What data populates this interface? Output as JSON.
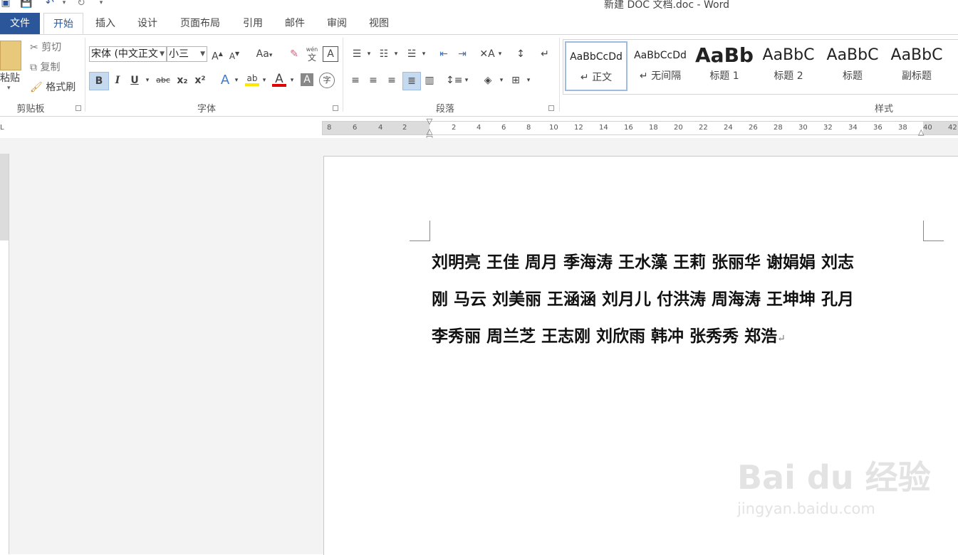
{
  "title": "新建 DOC 文档.doc - Word",
  "tabs": [
    {
      "label": "文件"
    },
    {
      "label": "开始"
    },
    {
      "label": "插入"
    },
    {
      "label": "设计"
    },
    {
      "label": "页面布局"
    },
    {
      "label": "引用"
    },
    {
      "label": "邮件"
    },
    {
      "label": "审阅"
    },
    {
      "label": "视图"
    }
  ],
  "clipboard": {
    "paste": "粘贴",
    "cut": "剪切",
    "copy": "复制",
    "format_painter": "格式刷",
    "group_label": "剪贴板"
  },
  "font": {
    "font_name": "宋体 (中文正文",
    "font_size": "小三",
    "group_label": "字体",
    "bold": "B",
    "italic": "I",
    "underline": "U",
    "strike": "abc",
    "subscript": "x₂",
    "superscript": "x²",
    "change_case": "Aa",
    "font_color_letter": "A",
    "phonetic": "wén",
    "phonetic2": "文"
  },
  "paragraph": {
    "group_label": "段落"
  },
  "styles": {
    "group_label": "样式",
    "items": [
      {
        "preview": "AaBbCcDd",
        "label": "↵ 正文"
      },
      {
        "preview": "AaBbCcDd",
        "label": "↵ 无间隔"
      },
      {
        "preview": "AaBb",
        "label": "标题 1"
      },
      {
        "preview": "AaBbC",
        "label": "标题 2"
      },
      {
        "preview": "AaBbC",
        "label": "标题"
      },
      {
        "preview": "AaBbC",
        "label": "副标题"
      }
    ]
  },
  "ruler": {
    "left_ticks": [
      "8",
      "6",
      "4",
      "2"
    ],
    "right_ticks": [
      "2",
      "4",
      "6",
      "8",
      "10",
      "12",
      "14",
      "16",
      "18",
      "20",
      "22",
      "24",
      "26",
      "28",
      "30",
      "32",
      "34",
      "36",
      "38",
      "40",
      "42"
    ]
  },
  "document": {
    "lines": [
      "刘明亮  王佳  周月  季海涛  王水藻  王莉  张丽华  谢娟娟  刘志",
      "刚  马云  刘美丽  王涵涵  刘月儿  付洪涛  周海涛  王坤坤  孔月",
      "李秀丽  周兰芝  王志刚  刘欣雨  韩冲  张秀秀  郑浩"
    ],
    "paragraph_mark": "↵"
  },
  "watermark": {
    "brand": "Bai du 经验",
    "url": "jingyan.baidu.com"
  }
}
